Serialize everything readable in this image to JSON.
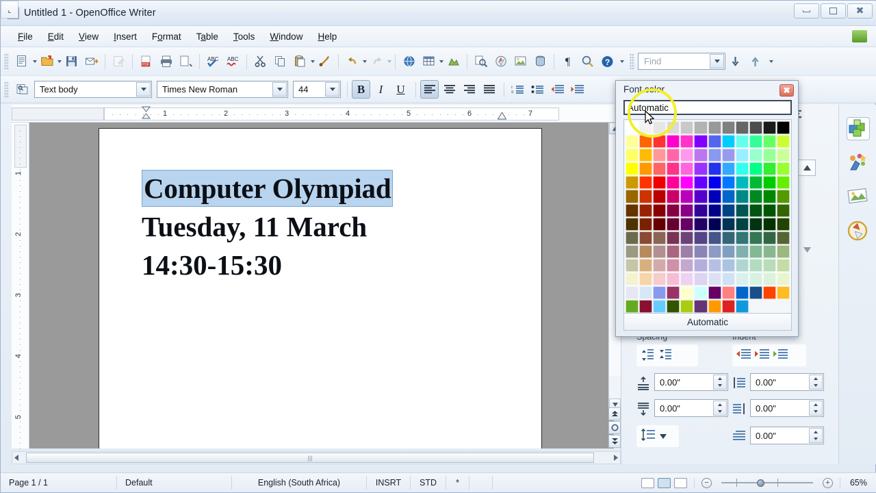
{
  "window": {
    "title": "Untitled 1 - OpenOffice Writer",
    "icon": "writer-document-icon",
    "minimize": "minimize-button",
    "maximize": "maximize-button",
    "close": "close-button"
  },
  "menubar": {
    "items": [
      "File",
      "Edit",
      "View",
      "Insert",
      "Format",
      "Table",
      "Tools",
      "Window",
      "Help"
    ]
  },
  "toolbar_standard": {
    "icons": [
      "new-document-icon",
      "open-document-icon",
      "save-icon",
      "email-document-icon",
      "edit-file-icon",
      "export-pdf-icon",
      "print-icon",
      "print-preview-icon",
      "spelling-check-icon",
      "autospellcheck-icon",
      "cut-icon",
      "copy-icon",
      "paste-icon",
      "clone-formatting-icon",
      "undo-icon",
      "redo-icon",
      "hyperlink-icon",
      "table-icon",
      "show-draw-functions-icon",
      "find-replace-icon",
      "navigator-icon",
      "gallery-icon",
      "data-sources-icon",
      "formatting-marks-icon",
      "zoom-icon",
      "help-icon"
    ],
    "find_placeholder": "Find",
    "find_value": "",
    "find_down": "find-next-icon",
    "find_up": "find-previous-icon"
  },
  "toolbar_formatting": {
    "paragraph_style_icon": "apply-style-icon",
    "paragraph_style": "Text body",
    "font_name": "Times New Roman",
    "font_size": "44",
    "bold": "B",
    "italic": "I",
    "underline": "U",
    "bold_active": true,
    "align_left_active": true,
    "buttons": [
      "align-left-button",
      "align-center-button",
      "align-right-button",
      "justified-button",
      "ordered-list-button",
      "unordered-list-button",
      "decrease-indent-button",
      "increase-indent-button"
    ]
  },
  "ruler": {
    "horizontal_marks": [
      "1",
      "2",
      "3",
      "4",
      "5",
      "6",
      "7"
    ],
    "vertical_marks": [
      "1",
      "2",
      "3",
      "4",
      "5"
    ],
    "tab_corner": "tab-stop-selector"
  },
  "document": {
    "lines": [
      {
        "text": "Computer Olympiad",
        "selected": true
      },
      {
        "text": "Tuesday, 11 March",
        "selected": false
      },
      {
        "text": "14:30-15:30",
        "selected": false
      }
    ],
    "selection_color": "#b8d4ee"
  },
  "font_color_dialog": {
    "title": "Font color",
    "close_label": "✖",
    "automatic_top": "Automatic",
    "automatic_bottom": "Automatic",
    "highlight_color": "#f2ef2b",
    "grid_columns": 12,
    "colors": [
      "#ffffff",
      "#f2f2f2",
      "#e6e6e6",
      "#d9d9d9",
      "#c9c9c9",
      "#b3b3b3",
      "#999999",
      "#808080",
      "#666666",
      "#4d4d4d",
      "#1a1a1a",
      "#000000",
      "#ffff99",
      "#ff6600",
      "#ff3333",
      "#ff00cc",
      "#ff33cc",
      "#8000ff",
      "#5566ee",
      "#00ccff",
      "#66ffee",
      "#33ff99",
      "#66ff66",
      "#ccff33",
      "#ffff66",
      "#ffbb00",
      "#ff9999",
      "#ff66aa",
      "#ff99ee",
      "#bb77ee",
      "#8899ee",
      "#9999ee",
      "#99eeff",
      "#99ffcc",
      "#99ff99",
      "#ccff99",
      "#ffff00",
      "#ff9900",
      "#ff6666",
      "#ff3388",
      "#ff66dd",
      "#9933ff",
      "#2233ee",
      "#33aaff",
      "#33ffee",
      "#00ff88",
      "#33ee33",
      "#99ff33",
      "#cc9900",
      "#ff3300",
      "#ee0000",
      "#ff0099",
      "#ff00ff",
      "#6600ff",
      "#0000ee",
      "#0077ff",
      "#00bbbb",
      "#00bb33",
      "#00cc00",
      "#66ee00",
      "#996600",
      "#cc3300",
      "#bb0000",
      "#cc0066",
      "#bb00bb",
      "#5500cc",
      "#0000bb",
      "#0066cc",
      "#008888",
      "#008822",
      "#008800",
      "#559900",
      "#663300",
      "#992200",
      "#880000",
      "#880044",
      "#880088",
      "#330099",
      "#000088",
      "#004488",
      "#005555",
      "#005511",
      "#005500",
      "#336600",
      "#4d3300",
      "#7a2200",
      "#660000",
      "#660033",
      "#660066",
      "#220066",
      "#000055",
      "#003355",
      "#004444",
      "#003311",
      "#003300",
      "#224400",
      "#6b6b4d",
      "#8a4a33",
      "#8a6655",
      "#7a3355",
      "#6b4477",
      "#554488",
      "#445588",
      "#336677",
      "#337777",
      "#337755",
      "#336644",
      "#556633",
      "#9a9a80",
      "#b58a5e",
      "#b09090",
      "#a8677f",
      "#9d7fa8",
      "#8b85b5",
      "#8c9ac4",
      "#7f9fc0",
      "#83b0ae",
      "#83b894",
      "#89b890",
      "#9ab87f",
      "#c6c6a6",
      "#d8b07e",
      "#d2aaaa",
      "#cf90a8",
      "#c4a8cf",
      "#b3aedd",
      "#b6c0e2",
      "#a8c4e0",
      "#b1d6d2",
      "#b1dcc0",
      "#b9dcb8",
      "#c6dca6",
      "#f3f3cf",
      "#f7d5a8",
      "#f7cccc",
      "#f5bdd3",
      "#eed2f0",
      "#ddd3f2",
      "#dde0f5",
      "#cfe2f5",
      "#d9f0ec",
      "#d7f2e0",
      "#dcf2da",
      "#eaf5cf",
      "#e6e6f5",
      "#d6e8f7",
      "#8899ee",
      "#993366",
      "#ffffcc",
      "#ccffff",
      "#660066",
      "#ff8080",
      "#0066cc",
      "#1a4e8a",
      "#ff4400",
      "#ffbb22",
      "#66aa22",
      "#8a1030",
      "#66ccff",
      "#335500",
      "#aacc11",
      "#663377",
      "#ff9900",
      "#dd2222",
      "#1199dd"
    ]
  },
  "sidebar": {
    "close_icon": "close-sidebar-icon",
    "menu_icon": "sidebar-settings-icon",
    "sections": {
      "spacing": "Spacing",
      "indent": "Indent"
    },
    "spacing_buttons": [
      "increase-paragraph-spacing-icon",
      "decrease-paragraph-spacing-icon"
    ],
    "indent_buttons": [
      "increase-indent-icon",
      "decrease-indent-icon",
      "hanging-indent-icon"
    ],
    "spacing_above": "0.00\"",
    "spacing_below": "0.00\"",
    "indent_before": "0.00\"",
    "indent_after": "0.00\"",
    "indent_first_line": "0.00\"",
    "line_spacing_icon": "line-spacing-icon",
    "tabs": [
      "gallery-tab-icon",
      "styles-tab-icon",
      "image-tab-icon",
      "navigator-tab-icon"
    ]
  },
  "statusbar": {
    "page": "Page 1 / 1",
    "style": "Default",
    "language": "English (South Africa)",
    "insert_mode": "INSRT",
    "selection_mode": "STD",
    "modified": "*",
    "view_single": "single-page-view-icon",
    "view_multi": "multi-page-view-icon",
    "view_book": "book-view-icon",
    "zoom_out": "−",
    "zoom_in": "+",
    "zoom_level": "65%"
  }
}
